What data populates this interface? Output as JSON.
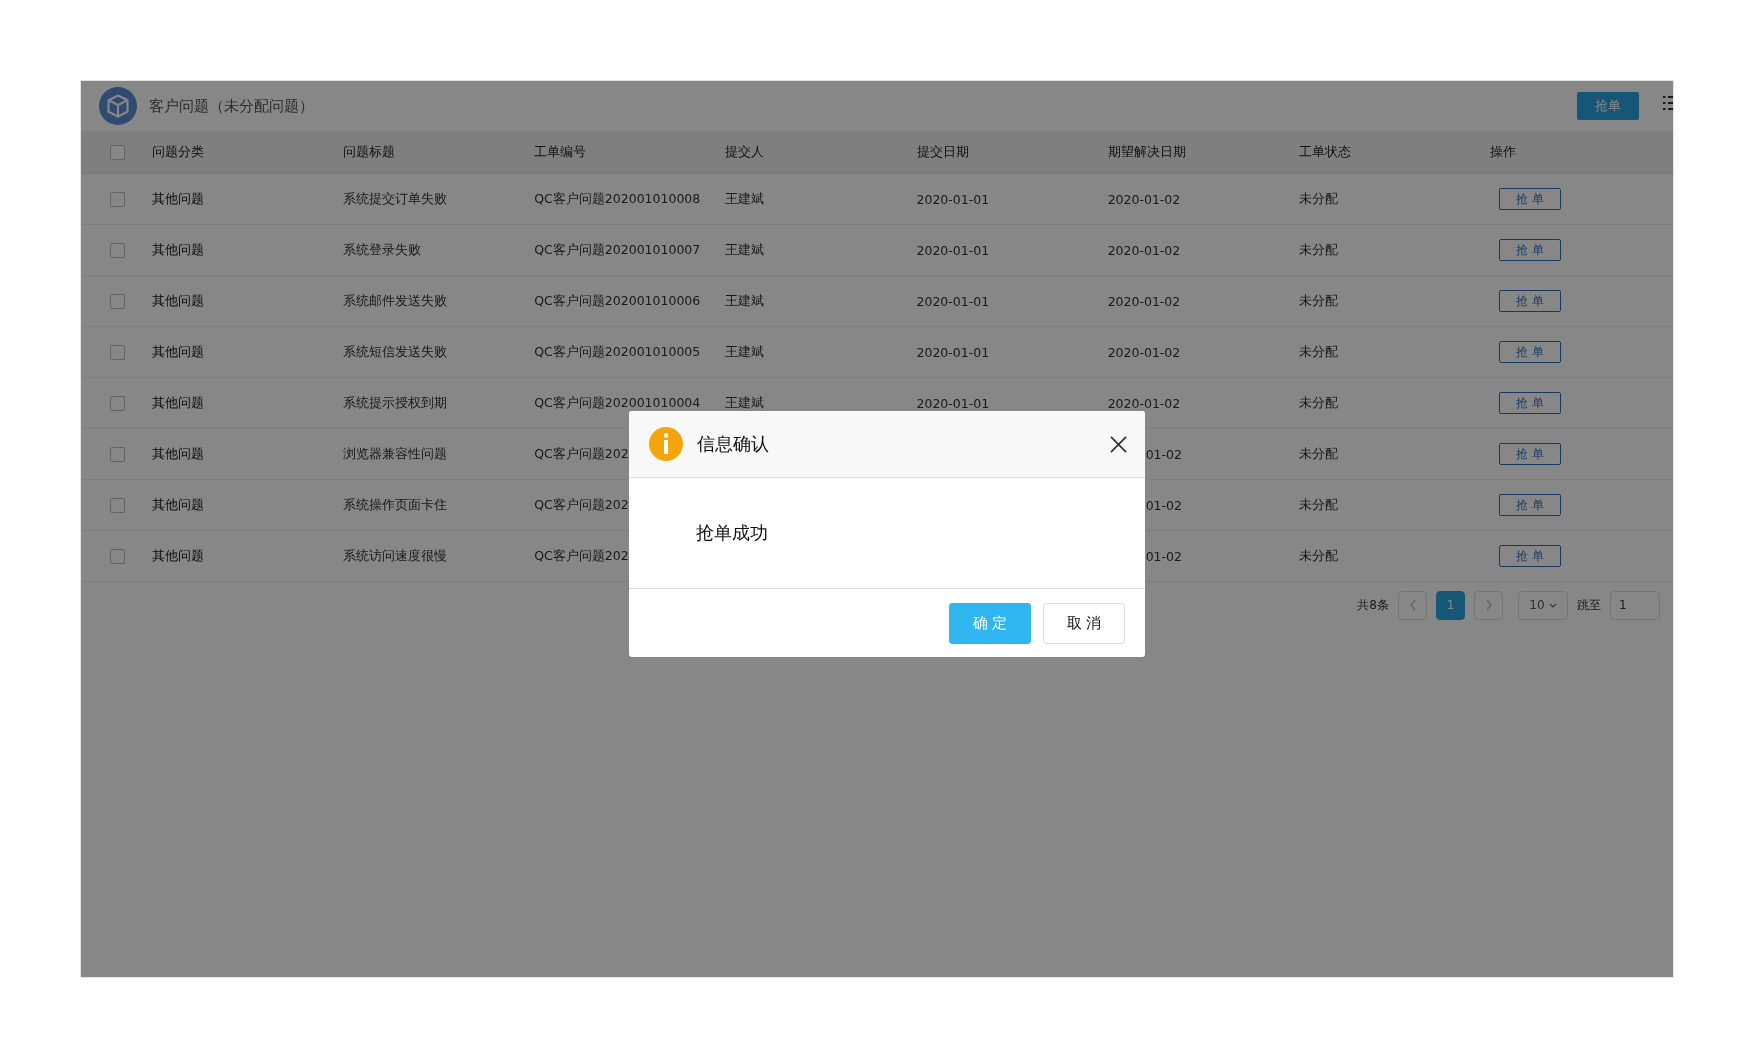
{
  "header": {
    "title": "客户问题（未分配问题）",
    "action_button": "抢单"
  },
  "table": {
    "select_all_checked": false,
    "columns": [
      "问题分类",
      "问题标题",
      "工单编号",
      "提交人",
      "提交日期",
      "期望解决日期",
      "工单状态",
      "操作"
    ],
    "rows": [
      {
        "checked": false,
        "category": "其他问题",
        "title": "系统提交订单失败",
        "ticket_no": "QC客户问题202001010008",
        "submitter": "王建斌",
        "submit_date": "2020-01-01",
        "expected_date": "2020-01-02",
        "status": "未分配",
        "action": "抢 单"
      },
      {
        "checked": false,
        "category": "其他问题",
        "title": "系统登录失败",
        "ticket_no": "QC客户问题202001010007",
        "submitter": "王建斌",
        "submit_date": "2020-01-01",
        "expected_date": "2020-01-02",
        "status": "未分配",
        "action": "抢 单"
      },
      {
        "checked": false,
        "category": "其他问题",
        "title": "系统邮件发送失败",
        "ticket_no": "QC客户问题202001010006",
        "submitter": "王建斌",
        "submit_date": "2020-01-01",
        "expected_date": "2020-01-02",
        "status": "未分配",
        "action": "抢 单"
      },
      {
        "checked": false,
        "category": "其他问题",
        "title": "系统短信发送失败",
        "ticket_no": "QC客户问题202001010005",
        "submitter": "王建斌",
        "submit_date": "2020-01-01",
        "expected_date": "2020-01-02",
        "status": "未分配",
        "action": "抢 单"
      },
      {
        "checked": false,
        "category": "其他问题",
        "title": "系统提示授权到期",
        "ticket_no": "QC客户问题202001010004",
        "submitter": "王建斌",
        "submit_date": "2020-01-01",
        "expected_date": "2020-01-02",
        "status": "未分配",
        "action": "抢 单"
      },
      {
        "checked": false,
        "category": "其他问题",
        "title": "浏览器兼容性问题",
        "ticket_no": "QC客户问题202",
        "expected_date": "01-02",
        "status": "未分配",
        "action": "抢 单"
      },
      {
        "checked": false,
        "category": "其他问题",
        "title": "系统操作页面卡住",
        "ticket_no": "QC客户问题202",
        "expected_date": "01-02",
        "status": "未分配",
        "action": "抢 单"
      },
      {
        "checked": false,
        "category": "其他问题",
        "title": "系统访问速度很慢",
        "ticket_no": "QC客户问题202",
        "expected_date": "01-02",
        "status": "未分配",
        "action": "抢 单"
      }
    ]
  },
  "pagination": {
    "total": "共8条",
    "pages": [
      {
        "label": "1",
        "selected": true
      }
    ],
    "page_size": "10",
    "jump_label": "跳至",
    "jump_value": "1"
  },
  "dialog": {
    "title": "信息确认",
    "message": "抢单成功",
    "buttons": [
      {
        "label": "确 定",
        "kind": "primary"
      },
      {
        "label": "取 消",
        "kind": "default"
      }
    ]
  }
}
